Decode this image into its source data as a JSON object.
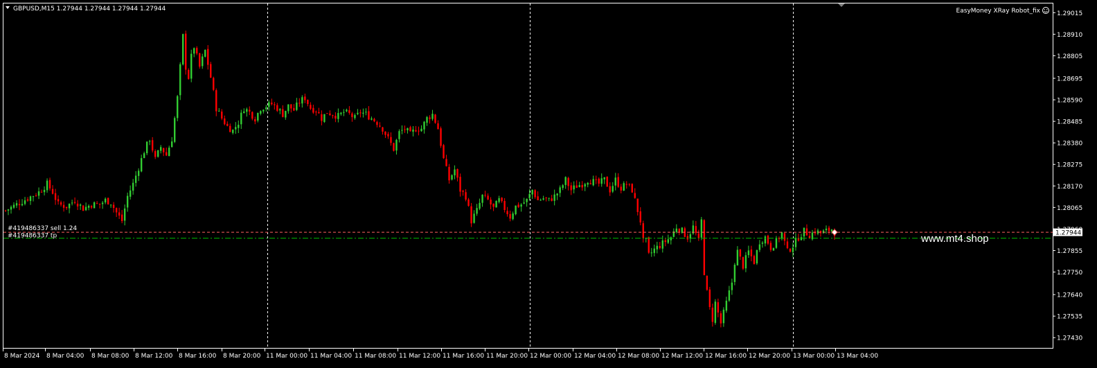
{
  "header": {
    "symbol_line": "GBPUSD,M15  1.27944 1.27944 1.27944 1.27944",
    "ea_label": "EasyMoney XRay Robot_fix"
  },
  "watermark": "www.mt4.shop",
  "orders": {
    "sell_label": "#419486337 sell 1.24",
    "tp_label": "#419486337 tp"
  },
  "colors": {
    "background": "#000000",
    "bull": "#32cd32",
    "bear": "#ff0000",
    "grid": "#ffffff",
    "sell_line": "#ff6060",
    "tp_line": "#00c000"
  },
  "chart_data": {
    "type": "candlestick",
    "symbol": "GBPUSD",
    "timeframe": "M15",
    "current_price": "1.27944",
    "ylim": [
      1.2738,
      1.2906
    ],
    "y_ticks": [
      "1.29015",
      "1.28910",
      "1.28805",
      "1.28695",
      "1.28590",
      "1.28485",
      "1.28380",
      "1.28275",
      "1.28170",
      "1.28065",
      "1.27960",
      "1.27855",
      "1.27750",
      "1.27640",
      "1.27535",
      "1.27430"
    ],
    "x_ticks": [
      "8 Mar 2024",
      "8 Mar 04:00",
      "8 Mar 08:00",
      "8 Mar 12:00",
      "8 Mar 16:00",
      "8 Mar 20:00",
      "11 Mar 00:00",
      "11 Mar 04:00",
      "11 Mar 08:00",
      "11 Mar 12:00",
      "11 Mar 16:00",
      "11 Mar 20:00",
      "12 Mar 00:00",
      "12 Mar 04:00",
      "12 Mar 08:00",
      "12 Mar 12:00",
      "12 Mar 16:00",
      "12 Mar 20:00",
      "13 Mar 00:00",
      "13 Mar 04:00"
    ],
    "day_separators": [
      "11 Mar 00:00",
      "12 Mar 00:00",
      "13 Mar 00:00"
    ],
    "sell_order_price": 1.27944,
    "tp_price": 1.27915,
    "close_path": [
      [
        0,
        1.2805
      ],
      [
        4,
        1.2808
      ],
      [
        8,
        1.2811
      ],
      [
        12,
        1.2814
      ],
      [
        15,
        1.2818
      ],
      [
        17,
        1.2814
      ],
      [
        19,
        1.2808
      ],
      [
        22,
        1.2807
      ],
      [
        25,
        1.281
      ],
      [
        28,
        1.2806
      ],
      [
        31,
        1.2808
      ],
      [
        34,
        1.2808
      ],
      [
        36,
        1.281
      ],
      [
        38,
        1.2809
      ],
      [
        40,
        1.2804
      ],
      [
        42,
        1.28
      ],
      [
        44,
        1.2812
      ],
      [
        46,
        1.2818
      ],
      [
        48,
        1.2826
      ],
      [
        50,
        1.2834
      ],
      [
        52,
        1.284
      ],
      [
        54,
        1.283
      ],
      [
        56,
        1.2836
      ],
      [
        58,
        1.2832
      ],
      [
        60,
        1.284
      ],
      [
        62,
        1.286
      ],
      [
        64,
        1.289
      ],
      [
        65,
        1.2875
      ],
      [
        66,
        1.287
      ],
      [
        67,
        1.288
      ],
      [
        68,
        1.2885
      ],
      [
        70,
        1.2875
      ],
      [
        72,
        1.2883
      ],
      [
        74,
        1.287
      ],
      [
        76,
        1.2855
      ],
      [
        78,
        1.285
      ],
      [
        80,
        1.2846
      ],
      [
        82,
        1.2844
      ],
      [
        84,
        1.2848
      ],
      [
        86,
        1.2855
      ],
      [
        88,
        1.2853
      ],
      [
        90,
        1.285
      ],
      [
        92,
        1.2855
      ],
      [
        94,
        1.2856
      ],
      [
        96,
        1.2857
      ],
      [
        98,
        1.2855
      ],
      [
        100,
        1.2852
      ],
      [
        102,
        1.2856
      ],
      [
        104,
        1.2854
      ],
      [
        106,
        1.2858
      ],
      [
        108,
        1.286
      ],
      [
        110,
        1.2855
      ],
      [
        112,
        1.2854
      ],
      [
        114,
        1.285
      ],
      [
        116,
        1.2853
      ],
      [
        118,
        1.2852
      ],
      [
        120,
        1.2851
      ],
      [
        122,
        1.2853
      ],
      [
        124,
        1.2852
      ],
      [
        126,
        1.285
      ],
      [
        128,
        1.2853
      ],
      [
        130,
        1.2852
      ],
      [
        132,
        1.285
      ],
      [
        134,
        1.2848
      ],
      [
        136,
        1.2845
      ],
      [
        138,
        1.284
      ],
      [
        140,
        1.2835
      ],
      [
        142,
        1.2843
      ],
      [
        144,
        1.2845
      ],
      [
        146,
        1.2842
      ],
      [
        148,
        1.2845
      ],
      [
        150,
        1.2845
      ],
      [
        152,
        1.285
      ],
      [
        154,
        1.2852
      ],
      [
        156,
        1.2845
      ],
      [
        158,
        1.283
      ],
      [
        160,
        1.282
      ],
      [
        162,
        1.2825
      ],
      [
        164,
        1.2815
      ],
      [
        166,
        1.2812
      ],
      [
        168,
        1.28
      ],
      [
        170,
        1.2805
      ],
      [
        172,
        1.2812
      ],
      [
        174,
        1.281
      ],
      [
        176,
        1.2806
      ],
      [
        178,
        1.281
      ],
      [
        180,
        1.2806
      ],
      [
        182,
        1.2802
      ],
      [
        184,
        1.2807
      ],
      [
        186,
        1.2808
      ],
      [
        188,
        1.281
      ],
      [
        190,
        1.2815
      ],
      [
        192,
        1.281
      ],
      [
        194,
        1.2811
      ],
      [
        196,
        1.281
      ],
      [
        198,
        1.2812
      ],
      [
        200,
        1.2815
      ],
      [
        202,
        1.282
      ],
      [
        204,
        1.2815
      ],
      [
        206,
        1.2817
      ],
      [
        208,
        1.2818
      ],
      [
        210,
        1.282
      ],
      [
        212,
        1.2819
      ],
      [
        214,
        1.2818
      ],
      [
        216,
        1.282
      ],
      [
        218,
        1.2815
      ],
      [
        220,
        1.282
      ],
      [
        222,
        1.2816
      ],
      [
        224,
        1.2818
      ],
      [
        226,
        1.2815
      ],
      [
        228,
        1.2805
      ],
      [
        229,
        1.28
      ],
      [
        230,
        1.279
      ],
      [
        231,
        1.279
      ],
      [
        232,
        1.2783
      ],
      [
        234,
        1.2786
      ],
      [
        236,
        1.2788
      ],
      [
        238,
        1.279
      ],
      [
        240,
        1.2792
      ],
      [
        242,
        1.2797
      ],
      [
        244,
        1.2795
      ],
      [
        246,
        1.2792
      ],
      [
        248,
        1.2797
      ],
      [
        250,
        1.279
      ],
      [
        251,
        1.28
      ],
      [
        252,
        1.2775
      ],
      [
        253,
        1.2765
      ],
      [
        254,
        1.2757
      ],
      [
        255,
        1.2752
      ],
      [
        256,
        1.276
      ],
      [
        258,
        1.275
      ],
      [
        260,
        1.276
      ],
      [
        262,
        1.277
      ],
      [
        263,
        1.278
      ],
      [
        264,
        1.2785
      ],
      [
        266,
        1.2778
      ],
      [
        268,
        1.2785
      ],
      [
        270,
        1.278
      ],
      [
        272,
        1.279
      ],
      [
        274,
        1.2792
      ],
      [
        276,
        1.2787
      ],
      [
        278,
        1.279
      ],
      [
        280,
        1.2794
      ],
      [
        282,
        1.2785
      ],
      [
        284,
        1.2788
      ],
      [
        286,
        1.2792
      ],
      [
        288,
        1.2795
      ],
      [
        290,
        1.2793
      ],
      [
        292,
        1.2795
      ],
      [
        294,
        1.2794
      ],
      [
        296,
        1.2795
      ],
      [
        298,
        1.2796
      ],
      [
        299,
        1.27944
      ]
    ]
  }
}
